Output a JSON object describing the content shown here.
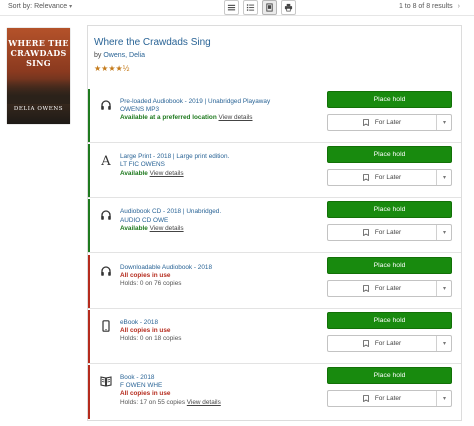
{
  "toolbar": {
    "sort_label": "Sort by: Relevance",
    "results_text": "1 to 8 of 8 results",
    "view_buttons": [
      "list-view",
      "detailed-list-view",
      "covers-view",
      "print"
    ]
  },
  "item": {
    "cover_title": "WHERE THE CRAWDADS SING",
    "cover_author": "DELIA OWENS",
    "title": "Where the Crawdads Sing",
    "by_prefix": "by",
    "author": "Owens, Delia",
    "stars": "★★★★½"
  },
  "colors": {
    "available": "#1f7a1f",
    "unavailable": "#b52b1d",
    "hold_button": "#188a0e",
    "link": "#2a6496"
  },
  "formats": [
    {
      "icon": "headphones-icon",
      "name": "Pre-loaded Audiobook - 2019 | Unabridged Playaway",
      "call_number": "OWENS MP3",
      "availability": "Available at a preferred location",
      "available": true,
      "holds": "",
      "view_details": "View details",
      "hold_label": "Place hold",
      "later_label": "For Later"
    },
    {
      "icon": "large-print-icon",
      "name": "Large Print - 2018 | Large print edition.",
      "call_number": "LT FIC OWENS",
      "availability": "Available",
      "available": true,
      "holds": "",
      "view_details": "View details",
      "hold_label": "Place hold",
      "later_label": "For Later"
    },
    {
      "icon": "headphones-icon",
      "name": "Audiobook CD - 2018 | Unabridged.",
      "call_number": "AUDIO CD OWE",
      "availability": "Available",
      "available": true,
      "holds": "",
      "view_details": "View details",
      "hold_label": "Place hold",
      "later_label": "For Later"
    },
    {
      "icon": "headphones-icon",
      "name": "Downloadable Audiobook - 2018",
      "call_number": "",
      "availability": "All copies in use",
      "available": false,
      "holds": "Holds: 0 on 76 copies",
      "view_details": "",
      "hold_label": "Place hold",
      "later_label": "For Later"
    },
    {
      "icon": "tablet-icon",
      "name": "eBook - 2018",
      "call_number": "",
      "availability": "All copies in use",
      "available": false,
      "holds": "Holds: 0 on 18 copies",
      "view_details": "",
      "hold_label": "Place hold",
      "later_label": "For Later"
    },
    {
      "icon": "book-icon",
      "name": "Book - 2018",
      "call_number": "F OWEN WHE",
      "availability": "All copies in use",
      "available": false,
      "holds": "Holds: 17 on 55 copies",
      "view_details": "View details",
      "hold_label": "Place hold",
      "later_label": "For Later"
    }
  ]
}
